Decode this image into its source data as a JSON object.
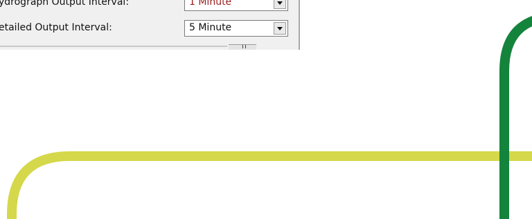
{
  "dialog": {
    "rows": [
      {
        "label": "ydrograph Output Interval:",
        "value": "1 Minute"
      },
      {
        "label": "etailed Output Interval:",
        "value": "5 Minute"
      }
    ]
  },
  "colors": {
    "panel_background": "#f0f0f0",
    "highlight_value_text": "#9a1c1c",
    "normal_value_text": "#111111",
    "yellow_green_curve": "#d5d84a",
    "green_curve": "#14833c"
  },
  "icons": {
    "dropdown_arrow": "chevron-down-icon",
    "resize_grip": "grip-icon"
  }
}
